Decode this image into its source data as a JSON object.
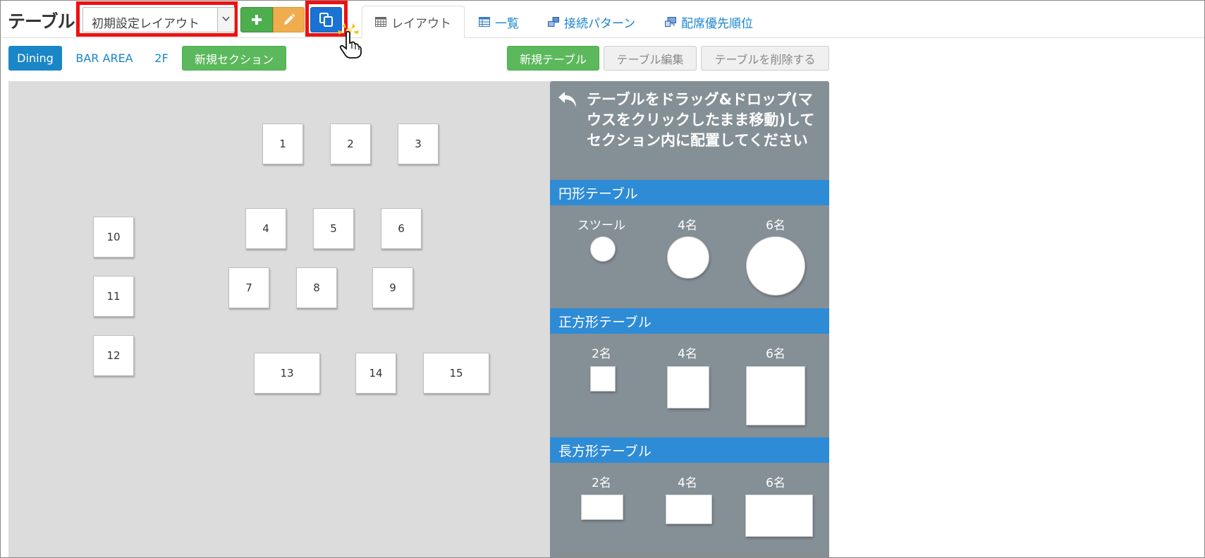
{
  "header": {
    "title": "テーブル",
    "layout_select": {
      "value": "初期設定レイアウト"
    },
    "tabs": [
      {
        "label": "レイアウト",
        "icon": "calendar-grid-icon",
        "active": true
      },
      {
        "label": "一覧",
        "icon": "table-list-icon"
      },
      {
        "label": "接続パターン",
        "icon": "link-squares-icon"
      },
      {
        "label": "配席優先順位",
        "icon": "priority-icon"
      }
    ]
  },
  "sections": {
    "items": [
      "Dining",
      "BAR AREA",
      "2F"
    ],
    "new_section": "新規セクション"
  },
  "table_actions": {
    "new": "新規テーブル",
    "edit": "テーブル編集",
    "delete": "テーブルを削除する"
  },
  "tables": [
    "1",
    "2",
    "3",
    "4",
    "5",
    "6",
    "7",
    "8",
    "9",
    "10",
    "11",
    "12",
    "13",
    "14",
    "15"
  ],
  "palette": {
    "instruction": "テーブルをドラッグ&ドロップ(マウスをクリックしたまま移動)してセクション内に配置してください",
    "round": {
      "title": "円形テーブル",
      "labels": [
        "スツール",
        "4名",
        "6名"
      ]
    },
    "square": {
      "title": "正方形テーブル",
      "labels": [
        "2名",
        "4名",
        "6名"
      ]
    },
    "rect": {
      "title": "長方形テーブル",
      "labels": [
        "2名",
        "4名",
        "6名"
      ]
    }
  },
  "colors": {
    "highlight": "#ee1111",
    "primary": "#1a86c8",
    "success": "#5cb85c",
    "warning": "#f0ad4e",
    "copy_button": "#1a73d4",
    "palette_bg": "#858f96",
    "palette_header": "#2e8bd6"
  }
}
